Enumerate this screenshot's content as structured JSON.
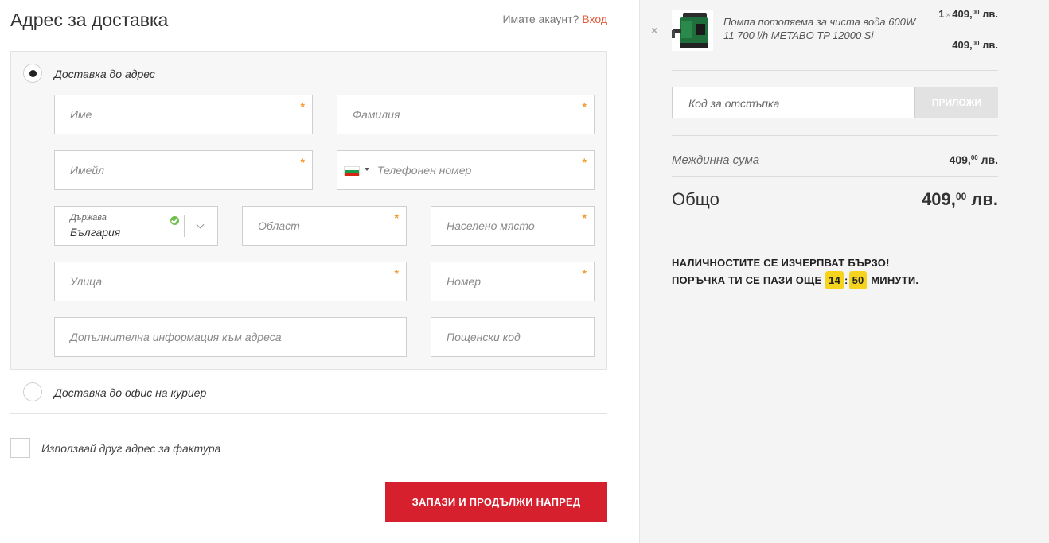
{
  "checkout": {
    "heading": "Адрес за доставка",
    "account_prompt": "Имате акаунт?",
    "login_link": "Вход",
    "delivery_address_option": "Доставка до адрес",
    "delivery_office_option": "Доставка до офис на куриер",
    "fields": {
      "first_name": "Име",
      "last_name": "Фамилия",
      "email": "Имейл",
      "phone": "Телефонен номер",
      "country_label": "Държава",
      "country_value": "България",
      "region": "Област",
      "city": "Населено място",
      "street": "Улица",
      "number": "Номер",
      "address_extra": "Допълнителна информация към адреса",
      "postcode": "Пощенски код"
    },
    "required_mark": "*",
    "billing_checkbox_label": "Използвай друг адрес за фактура",
    "submit_label": "ЗАПАЗИ И ПРОДЪЛЖИ НАПРЕД"
  },
  "cart": {
    "remove_symbol": "×",
    "product_name": "Помпа потопяема за чиста вода 600W 11 700 l/h METABO TP 12000 Si",
    "quantity": "1",
    "times": "×",
    "unit_price_main": "409,",
    "unit_price_cents": "00",
    "currency": "лв.",
    "line_total_main": "409,",
    "line_total_cents": "00",
    "coupon_placeholder": "Код за отстъпка",
    "coupon_button": "ПРИЛОЖИ",
    "subtotal_label": "Междинна сума",
    "subtotal_main": "409,",
    "subtotal_cents": "00",
    "total_label": "Общо",
    "total_main": "409,",
    "total_cents": "00",
    "urgency_line1": "НАЛИЧНОСТИТЕ СЕ ИЗЧЕРПВАТ БЪРЗО!",
    "urgency_line2_prefix": "ПОРЪЧКА ТИ СЕ ПАЗИ ОЩЕ",
    "timer_minutes": "14",
    "timer_sep": ":",
    "timer_seconds": "50",
    "urgency_suffix": "МИНУТИ."
  },
  "colors": {
    "accent": "#d6202e",
    "link": "#e05a3a",
    "required": "#f29a2e",
    "timer": "#f6d41d"
  },
  "icons": [
    "check-icon",
    "chevron-down-icon",
    "bulgaria-flag-icon",
    "remove-icon",
    "product-thumbnail"
  ]
}
